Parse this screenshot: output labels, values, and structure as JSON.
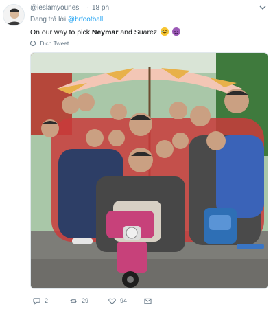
{
  "tweet": {
    "handle": "@ieslamyounes",
    "separator": "·",
    "time": "18 ph",
    "reply_prefix": "Đang trả lời",
    "reply_to": "@brfootball",
    "text_before": "On our way to pick",
    "text_bold": "Neymar",
    "text_after": "and Suarez",
    "translate": "Dịch Tweet",
    "emojis": [
      "😂",
      "😈"
    ]
  },
  "actions": {
    "replies": "2",
    "retweets": "29",
    "likes": "94"
  },
  "colors": {
    "link": "#1da1f2",
    "muted": "#657786",
    "text": "#14171a"
  }
}
